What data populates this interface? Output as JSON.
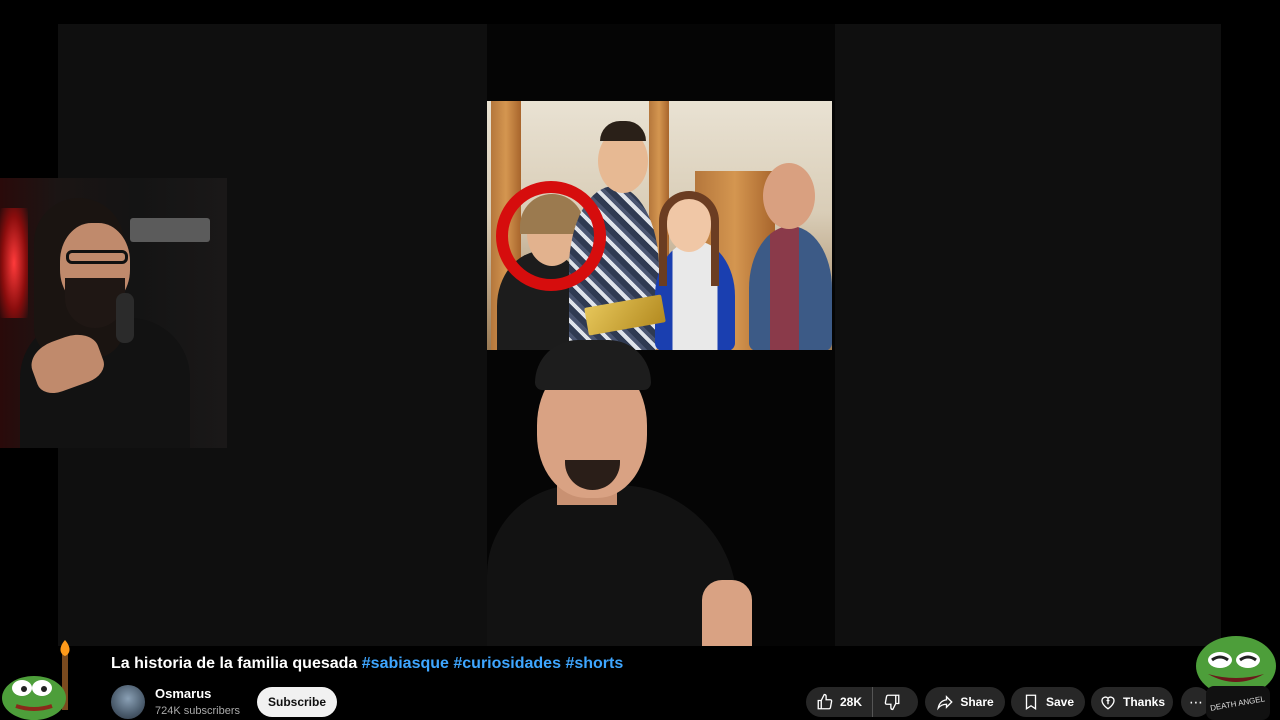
{
  "video": {
    "title_main": "La historia de la familia quesada",
    "hashtags": [
      "#sabiasque",
      "#curiosidades",
      "#shorts"
    ]
  },
  "channel": {
    "name": "Osmarus",
    "subscribers": "724K subscribers",
    "subscribe_label": "Subscribe"
  },
  "actions": {
    "like_count": "28K",
    "share_label": "Share",
    "save_label": "Save",
    "thanks_label": "Thanks"
  },
  "overlay": {
    "sticker_text": "DEATH ANGEL"
  },
  "colors": {
    "hashtag": "#3ea6ff",
    "highlight_circle": "#d60d0d",
    "pill_bg": "#272727",
    "subscribe_bg": "#f1f1f1"
  }
}
